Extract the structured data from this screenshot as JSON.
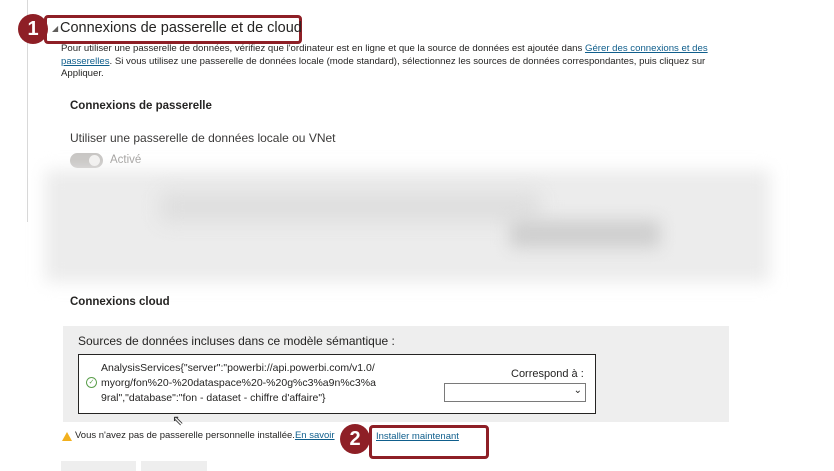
{
  "section": {
    "title": "Connexions de passerelle et de cloud",
    "description_prefix": "Pour utiliser une passerelle de données, vérifiez que l'ordinateur est en ligne et que la source de données est ajoutée dans ",
    "description_link": "Gérer des connexions et des passerelles",
    "description_suffix": ". Si vous utilisez une passerelle de données locale (mode standard), sélectionnez les sources de données correspondantes, puis cliquez sur Appliquer."
  },
  "gateway": {
    "heading": "Connexions de passerelle",
    "toggle_label": "Utiliser une passerelle de données locale ou VNet",
    "toggle_state": "Activé"
  },
  "cloud": {
    "heading": "Connexions cloud",
    "sources_title": "Sources de données incluses dans ce modèle sémantique :",
    "source_line1": "AnalysisServices{\"server\":\"powerbi://api.powerbi.com/v1.0/",
    "source_line2": "myorg/fon%20-%20dataspace%20-%20g%c3%a9n%c3%a",
    "source_line3": "9ral\",\"database\":\"fon - dataset - chiffre d'affaire\"}",
    "maps_to_label": "Correspond à :",
    "maps_to_value": ""
  },
  "warning": {
    "text": "Vous n'avez pas de passerelle personnelle installée.",
    "learn_more": "En savoir",
    "install_now": "Installer maintenant"
  },
  "callouts": {
    "one": "1",
    "two": "2"
  },
  "colors": {
    "callout": "#8e1f26",
    "link": "#0f5e8c",
    "warning": "#f2b01e",
    "success": "#5b9f4c"
  }
}
